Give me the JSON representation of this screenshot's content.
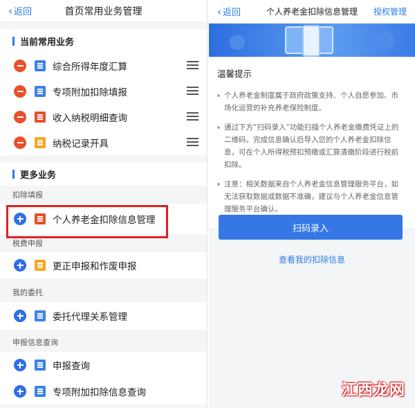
{
  "left": {
    "back_label": "返回",
    "title": "首页常用业务管理",
    "current_section": "当前常用业务",
    "current_items": [
      {
        "label": "综合所得年度汇算",
        "icon": "grid-icon"
      },
      {
        "label": "专项附加扣除填报",
        "icon": "doc-edit-icon"
      },
      {
        "label": "收入纳税明细查询",
        "icon": "shield-icon"
      },
      {
        "label": "纳税记录开具",
        "icon": "record-icon"
      }
    ],
    "more_section": "更多业务",
    "categories": [
      {
        "name": "扣除填报",
        "items": [
          {
            "label": "个人养老金扣除信息管理",
            "icon": "pension-icon"
          }
        ]
      },
      {
        "name": "税费申报",
        "items": [
          {
            "label": "更正申报和作废申报",
            "icon": "doc-correct-icon"
          }
        ]
      },
      {
        "name": "我的委托",
        "items": [
          {
            "label": "委托代理关系管理",
            "icon": "agency-icon"
          }
        ]
      },
      {
        "name": "申报信息查询",
        "items": [
          {
            "label": "申报查询",
            "icon": "doc-query-icon"
          },
          {
            "label": "专项附加扣除信息查询",
            "icon": "check-doc-icon"
          }
        ]
      }
    ]
  },
  "right": {
    "back_label": "返回",
    "title": "个人养老金扣除信息管理",
    "auth_label": "授权管理",
    "tips_title": "温馨提示",
    "tips": [
      "个人养老金制度属于政府政策支持、个人自愿参加、市场化运营的补充养老保险制度。",
      "通过下方“扫码录入”功能扫描个人养老金缴费凭证上的二维码，完成信息确认后导入您的个人养老金扣除信息，可在个人所得税预扣预缴或汇算清缴阶段进行税前扣除。",
      "注意：相关数据来自个人养老金信息管理服务平台，如无法获取数据或数据不准确，建议与个人养老金信息管理服务平台确认。"
    ],
    "scan_button": "扫码录入",
    "view_link": "查看我的扣除信息"
  },
  "watermark": "江西龙网",
  "colors": {
    "accent": "#2a7de1",
    "remove": "#e8512a",
    "add": "#2e6fe6",
    "highlight": "#e02020"
  }
}
